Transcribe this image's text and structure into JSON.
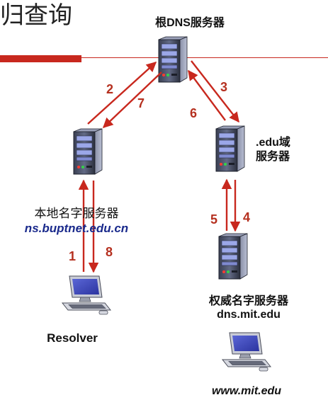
{
  "slide": {
    "title_fragment": "归查询"
  },
  "servers": {
    "root": {
      "label": "根DNS服务器"
    },
    "edu": {
      "label_line1": ".edu域",
      "label_line2": "服务器"
    },
    "local": {
      "label": "本地名字服务器",
      "host": "ns.buptnet.edu.cn"
    },
    "auth": {
      "label": "权威名字服务器",
      "host": "dns.mit.edu"
    }
  },
  "clients": {
    "resolver": {
      "label": "Resolver"
    },
    "www": {
      "label": "www.mit.edu"
    }
  },
  "steps": {
    "s1": "1",
    "s2": "2",
    "s3": "3",
    "s4": "4",
    "s5": "5",
    "s6": "6",
    "s7": "7",
    "s8": "8"
  },
  "colors": {
    "arrow": "#c8281e",
    "step_text": "#b5301f",
    "host_text": "#1a2a8c"
  }
}
